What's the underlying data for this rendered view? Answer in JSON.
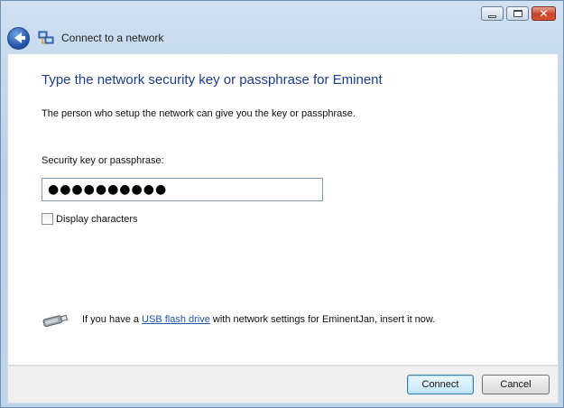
{
  "window": {
    "title": "Connect to a network",
    "controls": {
      "minimize": "minimize",
      "maximize": "maximize",
      "close": "✕"
    }
  },
  "nav": {
    "back_icon": "back-arrow-icon",
    "network_icon": "network-icon",
    "title": "Connect to a network"
  },
  "main": {
    "heading": "Type the network security key or passphrase for Eminent",
    "description": "The person who setup the network can give you the key or passphrase.",
    "field_label": "Security key or passphrase:",
    "password_value": "●●●●●●●●●●",
    "display_characters_label": "Display characters",
    "display_characters_checked": false,
    "usb": {
      "icon": "usb-drive-icon",
      "text_before": "If you have a ",
      "link_text": "USB flash drive",
      "text_after": " with network settings for EminentJan, insert it now."
    }
  },
  "footer": {
    "connect_label": "Connect",
    "cancel_label": "Cancel"
  },
  "colors": {
    "heading": "#1c3c8c",
    "link": "#1f53b5",
    "frame": "#b9d1ea"
  }
}
